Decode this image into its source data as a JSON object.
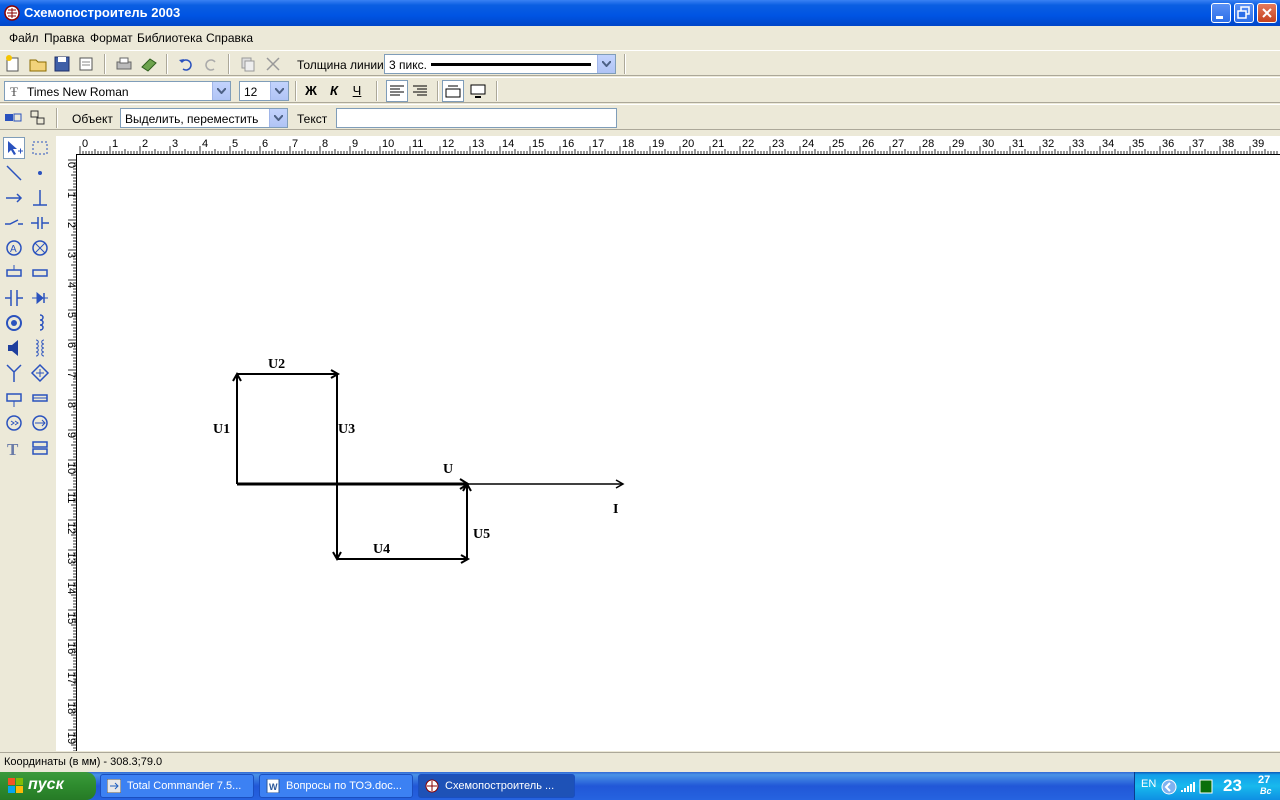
{
  "window": {
    "title": "Схемопостроитель 2003"
  },
  "menu": [
    "Файл",
    "Правка",
    "Формат",
    "Библиотека",
    "Справка"
  ],
  "toolbar1": {
    "line_width_label": "Толщина линии",
    "line_width_value": "3 пикс."
  },
  "toolbar2": {
    "font_name": "Times New Roman",
    "font_size": "12",
    "bold": "Ж",
    "italic": "К",
    "underline": "Ч"
  },
  "toolbar3": {
    "object_label": "Объект",
    "object_mode": "Выделить, переместить",
    "text_label": "Текст",
    "text_value": ""
  },
  "ruler": {
    "unit": "см",
    "top_ticks": [
      "0",
      "1",
      "2",
      "3",
      "4",
      "5",
      "6",
      "7",
      "8",
      "9",
      "10",
      "11",
      "12",
      "13",
      "14",
      "15",
      "16",
      "17",
      "18",
      "19",
      "20",
      "21",
      "22",
      "23",
      "24",
      "25",
      "26",
      "27",
      "28",
      "29",
      "30",
      "31",
      "32",
      "33",
      "34",
      "35",
      "36",
      "37",
      "38",
      "39"
    ],
    "left_ticks": [
      "0",
      "1",
      "2",
      "3",
      "4",
      "5",
      "6",
      "7",
      "8",
      "9",
      "10",
      "11",
      "12",
      "13",
      "14",
      "15",
      "16",
      "17",
      "18",
      "19"
    ]
  },
  "diagram": {
    "labels": {
      "u1": "U1",
      "u2": "U2",
      "u3": "U3",
      "u4": "U4",
      "u5": "U5",
      "u": "U",
      "i": "I"
    }
  },
  "status": {
    "coordinates": "Координаты (в мм) - 308.3;79.0"
  },
  "taskbar": {
    "start": "пуск",
    "tasks": [
      "Total Commander 7.5...",
      "Вопросы по ТОЭ.doc...",
      "Схемопостроитель ..."
    ],
    "lang": "EN",
    "clock_hm": "23",
    "clock_min": "27",
    "clock_day": "Вс"
  },
  "colors": {
    "titlebar": "#0054E3",
    "toolbar_bg": "#ECE9D8",
    "icon_blue": "#2A52BE"
  }
}
